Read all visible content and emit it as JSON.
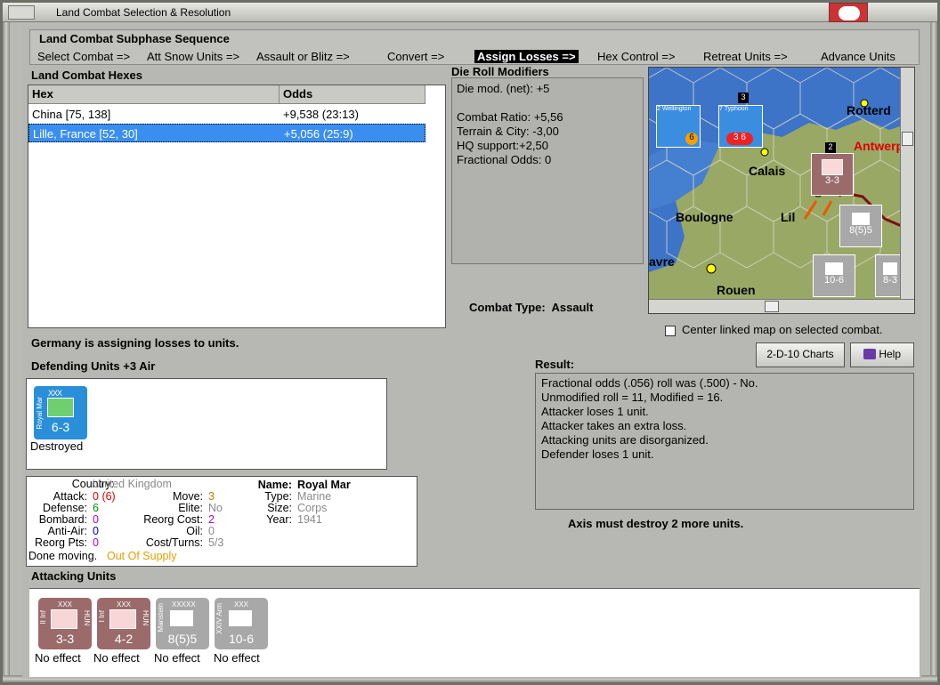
{
  "window": {
    "title": "Land Combat Selection & Resolution"
  },
  "sequence": {
    "title": "Land Combat Subphase Sequence",
    "steps": [
      "Select Combat =>",
      "Att Snow Units =>",
      "Assault or Blitz =>",
      "Convert =>",
      "Assign Losses =>",
      "Hex Control =>",
      "Retreat Units =>",
      "Advance Units"
    ],
    "active_step": "Assign Losses =>"
  },
  "hexes": {
    "title": "Land Combat Hexes",
    "headers": [
      "Hex",
      "Odds"
    ],
    "rows": [
      {
        "hex": "China [75, 138]",
        "odds": "+9,538 (23:13)"
      },
      {
        "hex": "Lille, France [52, 30]",
        "odds": "+5,056 (25:9)"
      }
    ]
  },
  "die_roll": {
    "title": "Die Roll Modifiers",
    "lines": [
      "Die mod. (net): +5",
      "",
      "Combat Ratio: +5,56",
      "Terrain & City: -3,00",
      "HQ support:+2,50",
      "Fractional Odds: 0"
    ]
  },
  "combat_type": {
    "label": "Combat Type:",
    "value": "Assault"
  },
  "map": {
    "cities": [
      "Rotterd",
      "Calais",
      "Antwerp",
      "Boulogne",
      "Lil",
      "avre",
      "Rouen"
    ],
    "units": [
      {
        "label": "2 Wellington",
        "value": "6"
      },
      {
        "label": "7 Typhoon",
        "value": "3 6"
      },
      {
        "label": "3-3"
      },
      {
        "label": "8(5)5"
      },
      {
        "label": "10-6"
      },
      {
        "label": "8-3"
      }
    ],
    "stack_numbers": [
      "3",
      "2"
    ]
  },
  "center_map": {
    "label": "Center linked map on selected combat.",
    "checked": false
  },
  "buttons": {
    "charts": "2-D-10 Charts",
    "help": "Help"
  },
  "status_msg": "Germany is assigning losses to units.",
  "defending": {
    "title": "Defending Units +3 Air",
    "unit": {
      "corps": "XXX",
      "side": "Royal Mar",
      "strength": "6-3",
      "status": "Destroyed",
      "color": "#2a8fd8"
    }
  },
  "info": {
    "country_label": "Country:",
    "country": "United Kingdom",
    "attack_label": "Attack:",
    "attack": "0",
    "attack_extra": "(6)",
    "defense_label": "Defense:",
    "defense": "6",
    "bombard_label": "Bombard:",
    "bombard": "0",
    "antiair_label": "Anti-Air:",
    "antiair": "0",
    "reorgpts_label": "Reorg Pts:",
    "reorgpts": "0",
    "move_label": "Move:",
    "move": "3",
    "elite_label": "Elite:",
    "elite": "No",
    "reorgcost_label": "Reorg Cost:",
    "reorgcost": "2",
    "oil_label": "Oil:",
    "oil": "0",
    "costturns_label": "Cost/Turns:",
    "costturns": "5/3",
    "name_label": "Name:",
    "name": "Royal Mar",
    "type_label": "Type:",
    "type": "Marine",
    "size_label": "Size:",
    "size": "Corps",
    "year_label": "Year:",
    "year": "1941",
    "done": "Done moving.",
    "supply": "Out Of Supply"
  },
  "result": {
    "title": "Result:",
    "lines": [
      "Fractional odds (.056) roll was (.500)  - No.",
      "Unmodified roll = 11, Modified = 16.",
      "Attacker loses 1 unit.",
      "Attacker takes an extra loss.",
      "Attacking units are disorganized.",
      "Defender loses 1 unit."
    ],
    "axis_msg": "Axis must destroy 2 more units."
  },
  "attacking": {
    "title": "Attacking Units",
    "units": [
      {
        "corps": "XXX",
        "side": "II Inf",
        "right": "HUN",
        "strength": "3-3",
        "status": "No effect",
        "color": "#9b6b6b"
      },
      {
        "corps": "XXX",
        "side": "I Inf",
        "right": "HUN",
        "strength": "4-2",
        "status": "No effect",
        "color": "#9b6b6b"
      },
      {
        "corps": "XXXXX",
        "side": "Manstein",
        "right": "",
        "strength": "8(5)5",
        "status": "No effect",
        "color": "#a8a8a8"
      },
      {
        "corps": "XXX",
        "side": "XXIV Arm",
        "right": "",
        "strength": "10-6",
        "status": "No effect",
        "color": "#a8a8a8"
      }
    ]
  }
}
